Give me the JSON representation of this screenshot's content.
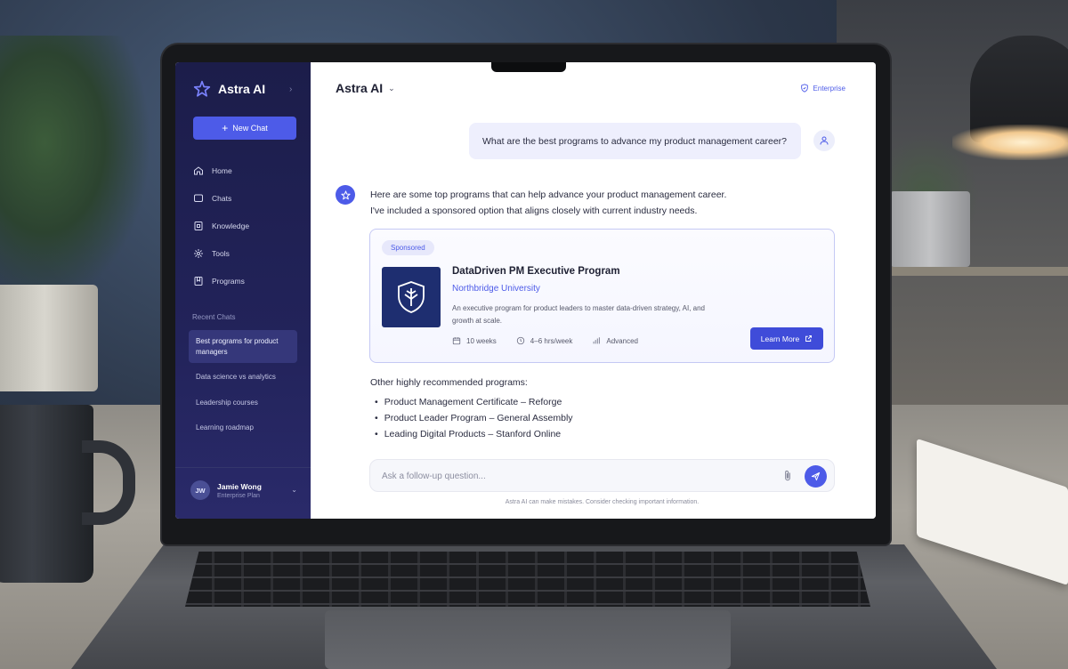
{
  "app": {
    "name": "Astra AI"
  },
  "sidebar": {
    "new_chat_label": "New Chat",
    "nav": [
      {
        "label": "Home",
        "icon": "home-icon"
      },
      {
        "label": "Chats",
        "icon": "chat-icon"
      },
      {
        "label": "Knowledge",
        "icon": "knowledge-icon"
      },
      {
        "label": "Tools",
        "icon": "tools-icon"
      },
      {
        "label": "Programs",
        "icon": "programs-icon"
      }
    ],
    "recent_title": "Recent Chats",
    "recent": [
      {
        "label": "Best programs for product managers",
        "active": true
      },
      {
        "label": "Data science vs analytics",
        "active": false
      },
      {
        "label": "Leadership courses",
        "active": false
      },
      {
        "label": "Learning roadmap",
        "active": false
      }
    ],
    "user": {
      "initials": "JW",
      "name": "Jamie Wong",
      "plan": "Enterprise Plan"
    }
  },
  "header": {
    "title": "Astra AI",
    "badge": "Enterprise"
  },
  "conversation": {
    "user_message": "What are the best programs to advance my product management career?",
    "assistant_intro_line1": "Here are some top programs that can help advance your product management career.",
    "assistant_intro_line2": "I've included a sponsored option that aligns closely with current industry needs.",
    "sponsored_card": {
      "tag": "Sponsored",
      "title": "DataDriven PM Executive Program",
      "institution": "Northbridge University",
      "description": "An executive program for product leaders to master data-driven strategy, AI, and growth at scale.",
      "duration": "10 weeks",
      "commitment": "4–6 hrs/week",
      "level": "Advanced",
      "cta": "Learn More"
    },
    "other_title": "Other highly recommended programs:",
    "other_programs": [
      "Product Management Certificate – Reforge",
      "Product Leader Program – General Assembly",
      "Leading Digital Products – Stanford Online"
    ]
  },
  "composer": {
    "placeholder": "Ask a follow-up question...",
    "disclaimer": "Astra AI can make mistakes. Consider checking important information."
  },
  "colors": {
    "accent": "#4d5be8",
    "sidebar_bg": "#1c1d4a",
    "card_border": "#c5c9f4"
  }
}
